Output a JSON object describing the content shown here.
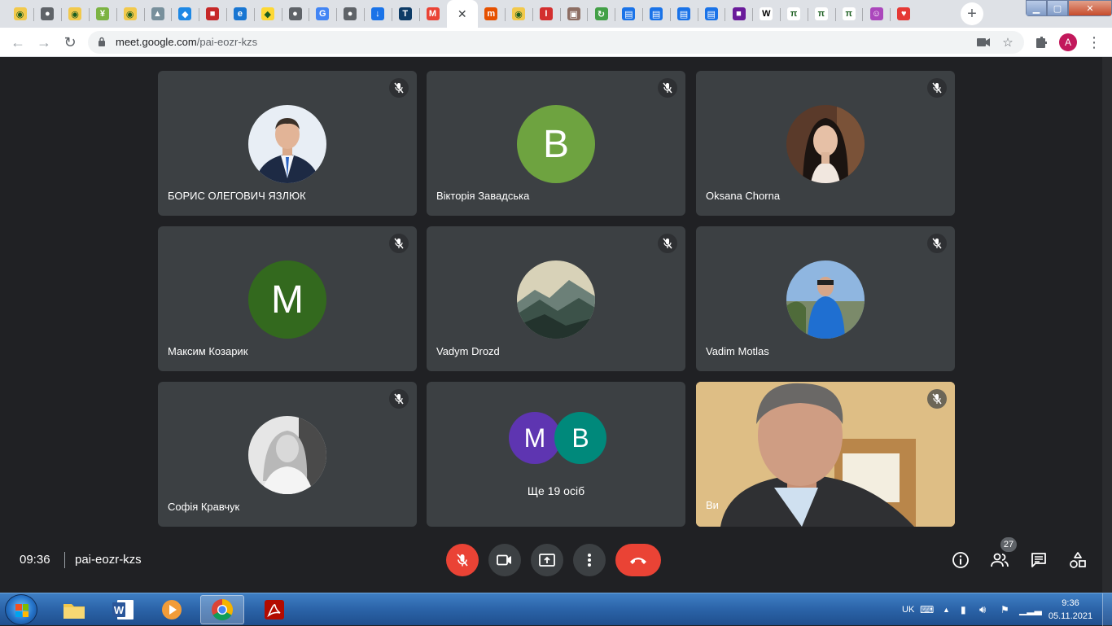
{
  "browser": {
    "url_host": "meet.google.com",
    "url_path": "/pai-eozr-kzs",
    "profile_initial": "A",
    "tabs": [
      {
        "icon": "globe-yellow-icon",
        "color": "#f2c94c",
        "glyph": "◉"
      },
      {
        "icon": "globe-icon",
        "color": "#5f6368",
        "glyph": "●"
      },
      {
        "icon": "globe-yellow-icon",
        "color": "#f2c94c",
        "glyph": "◉"
      },
      {
        "icon": "wheat-icon",
        "color": "#7cb342",
        "glyph": "¥"
      },
      {
        "icon": "globe-yellow-icon",
        "color": "#f2c94c",
        "glyph": "◉"
      },
      {
        "icon": "building-icon",
        "color": "#78909c",
        "glyph": "▲"
      },
      {
        "icon": "shield-icon",
        "color": "#1e88e5",
        "glyph": "◆"
      },
      {
        "icon": "red-badge-icon",
        "color": "#c62828",
        "glyph": "■"
      },
      {
        "icon": "edge-icon",
        "color": "#1976d2",
        "glyph": "e"
      },
      {
        "icon": "yellow-shield-icon",
        "color": "#fdd835",
        "glyph": "◆"
      },
      {
        "icon": "globe-icon",
        "color": "#5f6368",
        "glyph": "●"
      },
      {
        "icon": "translate-icon",
        "color": "#4285f4",
        "glyph": "G"
      },
      {
        "icon": "globe-icon",
        "color": "#5f6368",
        "glyph": "●"
      },
      {
        "icon": "download-icon",
        "color": "#1a73e8",
        "glyph": "↓"
      },
      {
        "icon": "t-icon",
        "color": "#0d3b66",
        "glyph": "T"
      },
      {
        "icon": "gmail-icon",
        "color": "#ea4335",
        "glyph": "M"
      },
      {
        "icon": "meet-tab-close-icon",
        "active": true
      },
      {
        "icon": "m-icon",
        "color": "#e65100",
        "glyph": "m"
      },
      {
        "icon": "globe-yellow-icon",
        "color": "#f2c94c",
        "glyph": "◉"
      },
      {
        "icon": "thermometer-icon",
        "color": "#d32f2f",
        "glyph": "I"
      },
      {
        "icon": "briefcase-icon",
        "color": "#8d6e63",
        "glyph": "▣"
      },
      {
        "icon": "recycle-icon",
        "color": "#43a047",
        "glyph": "↻"
      },
      {
        "icon": "docs-icon",
        "color": "#1a73e8",
        "glyph": "▤"
      },
      {
        "icon": "docs-icon",
        "color": "#1a73e8",
        "glyph": "▤"
      },
      {
        "icon": "docs-icon",
        "color": "#1a73e8",
        "glyph": "▤"
      },
      {
        "icon": "docs-icon",
        "color": "#1a73e8",
        "glyph": "▤"
      },
      {
        "icon": "purple-square-icon",
        "color": "#6a1b9a",
        "glyph": "■"
      },
      {
        "icon": "wikipedia-icon",
        "color": "#ffffff",
        "glyph": "W"
      },
      {
        "icon": "pi-icon",
        "color": "#ffffff",
        "glyph": "π"
      },
      {
        "icon": "pi-icon",
        "color": "#ffffff",
        "glyph": "π"
      },
      {
        "icon": "pi-icon",
        "color": "#ffffff",
        "glyph": "π"
      },
      {
        "icon": "smiley-icon",
        "color": "#ab47bc",
        "glyph": "☺"
      },
      {
        "icon": "heart-icon",
        "color": "#e53935",
        "glyph": "♥"
      }
    ]
  },
  "participants": [
    {
      "name": "БОРИС ОЛЕГОВИЧ ЯЗЛЮК",
      "avatar_type": "photo",
      "avatar": "man-in-suit-photo"
    },
    {
      "name": "Вікторія Завадська",
      "avatar_type": "letter",
      "letter": "В",
      "color": "#6ea340"
    },
    {
      "name": "Oksana Chorna",
      "avatar_type": "photo",
      "avatar": "woman-photo"
    },
    {
      "name": "Максим Козарик",
      "avatar_type": "letter",
      "letter": "М",
      "color": "#33691e"
    },
    {
      "name": "Vadym Drozd",
      "avatar_type": "photo",
      "avatar": "mountains-photo"
    },
    {
      "name": "Vadim Motlas",
      "avatar_type": "photo",
      "avatar": "man-blue-jacket-photo"
    },
    {
      "name": "Софія Кравчук",
      "avatar_type": "photo",
      "avatar": "woman-bw-photo"
    }
  ],
  "more_tile": {
    "letters": [
      "M",
      "B"
    ],
    "colors": [
      "#5e35b1",
      "#00897b"
    ],
    "text": "Ще 19 осіб"
  },
  "self_tile": {
    "name": "Ви"
  },
  "meeting": {
    "time": "09:36",
    "code": "pai-eozr-kzs",
    "participant_count": "27"
  },
  "taskbar": {
    "language": "UK",
    "time": "9:36",
    "date": "05.11.2021",
    "apps": [
      "explorer-icon",
      "word-icon",
      "media-player-icon",
      "chrome-icon",
      "acrobat-icon"
    ]
  }
}
